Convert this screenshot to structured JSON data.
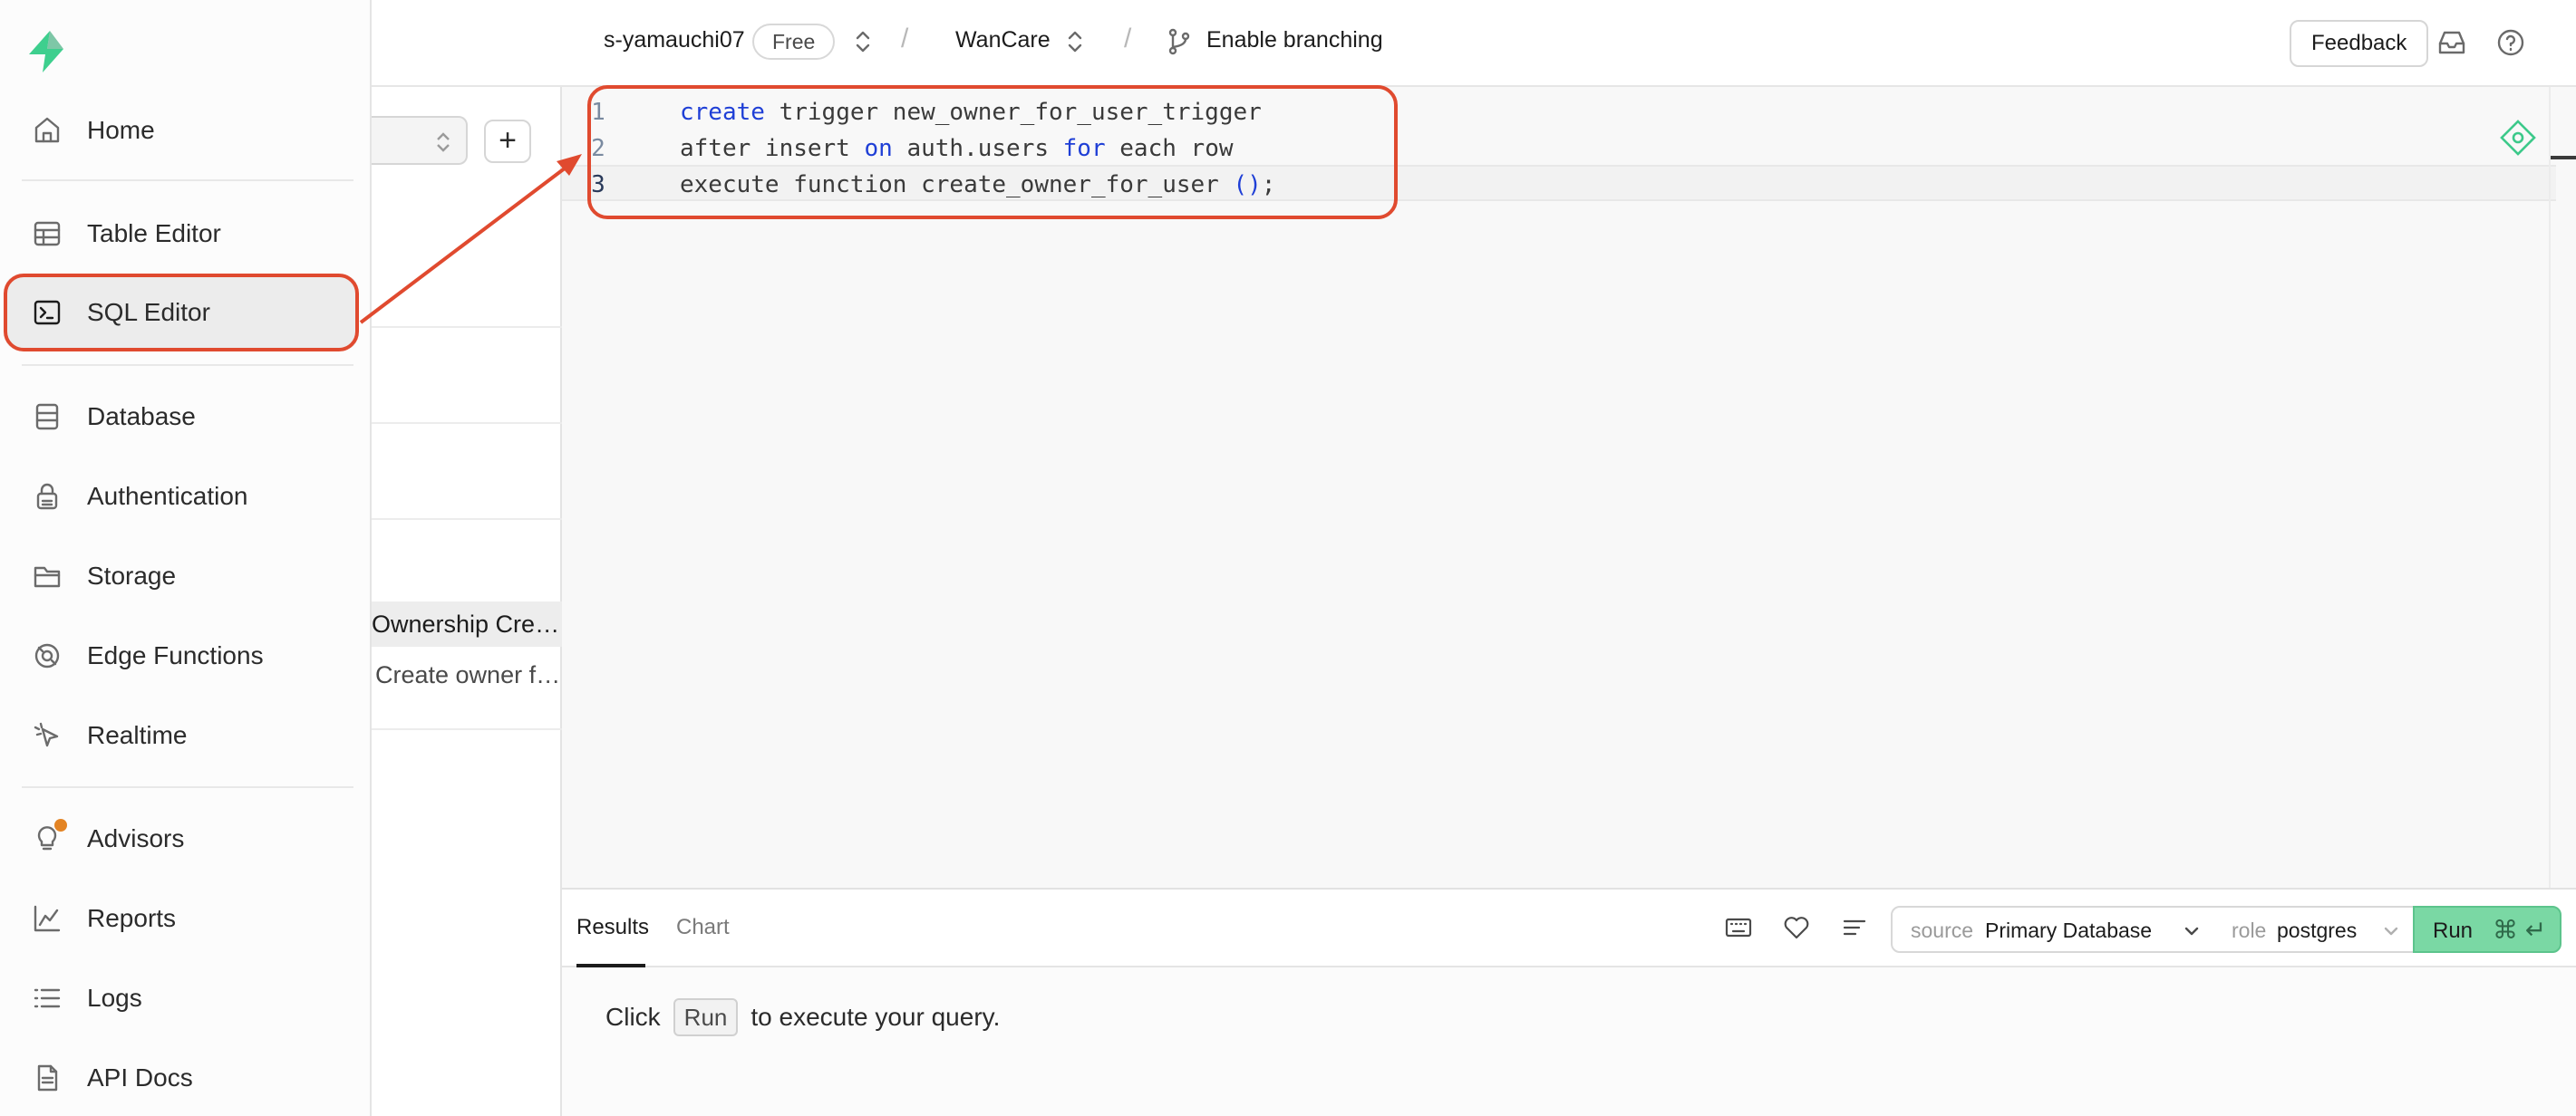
{
  "header": {
    "org": "s-yamauchi07",
    "plan_badge": "Free",
    "separator": "/",
    "project": "WanCare",
    "branch_label": "Enable branching",
    "feedback_label": "Feedback"
  },
  "sidebar": {
    "items": [
      {
        "label": "Home",
        "icon": "home-icon"
      },
      {
        "label": "Table Editor",
        "icon": "table-icon"
      },
      {
        "label": "SQL Editor",
        "icon": "terminal-icon",
        "active": true
      },
      {
        "label": "Database",
        "icon": "database-icon"
      },
      {
        "label": "Authentication",
        "icon": "lock-icon"
      },
      {
        "label": "Storage",
        "icon": "folder-icon"
      },
      {
        "label": "Edge Functions",
        "icon": "globe-icon"
      },
      {
        "label": "Realtime",
        "icon": "cursor-icon"
      },
      {
        "label": "Advisors",
        "icon": "bulb-icon"
      },
      {
        "label": "Reports",
        "icon": "chart-icon"
      },
      {
        "label": "Logs",
        "icon": "list-icon"
      },
      {
        "label": "API Docs",
        "icon": "doc-icon"
      }
    ]
  },
  "query_list": {
    "add_label": "+",
    "rows": [
      {
        "label": "Ownership Creation"
      },
      {
        "label": "Create owner for user"
      }
    ]
  },
  "editor": {
    "lines": [
      {
        "number": "1",
        "parts": [
          {
            "t": "create",
            "kw": true
          },
          {
            "t": " trigger new_owner_for_user_trigger",
            "kw": false
          }
        ]
      },
      {
        "number": "2",
        "parts": [
          {
            "t": "after insert ",
            "kw": false
          },
          {
            "t": "on",
            "kw": true
          },
          {
            "t": " auth.users ",
            "kw": false
          },
          {
            "t": "for",
            "kw": true
          },
          {
            "t": " each row",
            "kw": false
          }
        ]
      },
      {
        "number": "3",
        "parts": [
          {
            "t": "execute function create_owner_for_user ",
            "kw": false
          },
          {
            "t": "()",
            "kw": true
          },
          {
            "t": ";",
            "kw": false
          }
        ]
      }
    ]
  },
  "results": {
    "tabs": [
      {
        "label": "Results",
        "active": true
      },
      {
        "label": "Chart",
        "active": false
      }
    ],
    "source_prefix": "source",
    "source_value": "Primary Database",
    "role_prefix": "role",
    "role_value": "postgres",
    "run_label": "Run",
    "run_shortcut": "⌘ ↵",
    "hint_before": "Click",
    "hint_key": "Run",
    "hint_after": "to execute your query."
  },
  "colors": {
    "accent_green": "#3ecf8e",
    "annotation_red": "#e04a2f",
    "keyword_blue": "#1f3fd6"
  }
}
